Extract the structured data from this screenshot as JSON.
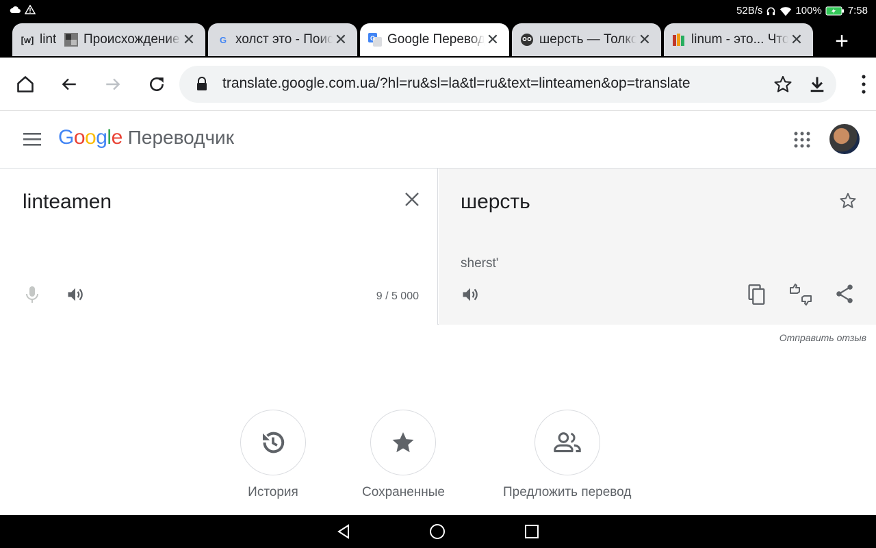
{
  "status_bar": {
    "net_speed": "52B/s",
    "battery": "100%",
    "time": "7:58"
  },
  "tabs": [
    {
      "favicon": "[w]",
      "title": "linteamen"
    },
    {
      "favicon": "img",
      "title": "Происхождение"
    },
    {
      "favicon": "G",
      "title": "холст это - Поиск"
    },
    {
      "favicon": "translate",
      "title": "Google Переводчик"
    },
    {
      "favicon": "owl",
      "title": "шерсть — Толковый"
    },
    {
      "favicon": "bars",
      "title": "linum - это... Что"
    }
  ],
  "omnibox": {
    "url": "translate.google.com.ua/?hl=ru&sl=la&tl=ru&text=linteamen&op=translate"
  },
  "app": {
    "logo": "Google",
    "product": "Переводчик"
  },
  "source": {
    "text": "linteamen",
    "counter": "9 / 5 000"
  },
  "target": {
    "text": "шерсть",
    "transliteration": "sherst'"
  },
  "feedback_link": "Отправить отзыв",
  "shortcuts": [
    {
      "icon": "history-icon",
      "label": "История"
    },
    {
      "icon": "star-icon",
      "label": "Сохраненные"
    },
    {
      "icon": "people-icon",
      "label": "Предложить перевод"
    }
  ],
  "colors": {
    "google_blue": "#4285F4",
    "google_red": "#EA4335",
    "google_yellow": "#FBBC05",
    "google_green": "#34A853",
    "icon_grey": "#5f6368"
  }
}
